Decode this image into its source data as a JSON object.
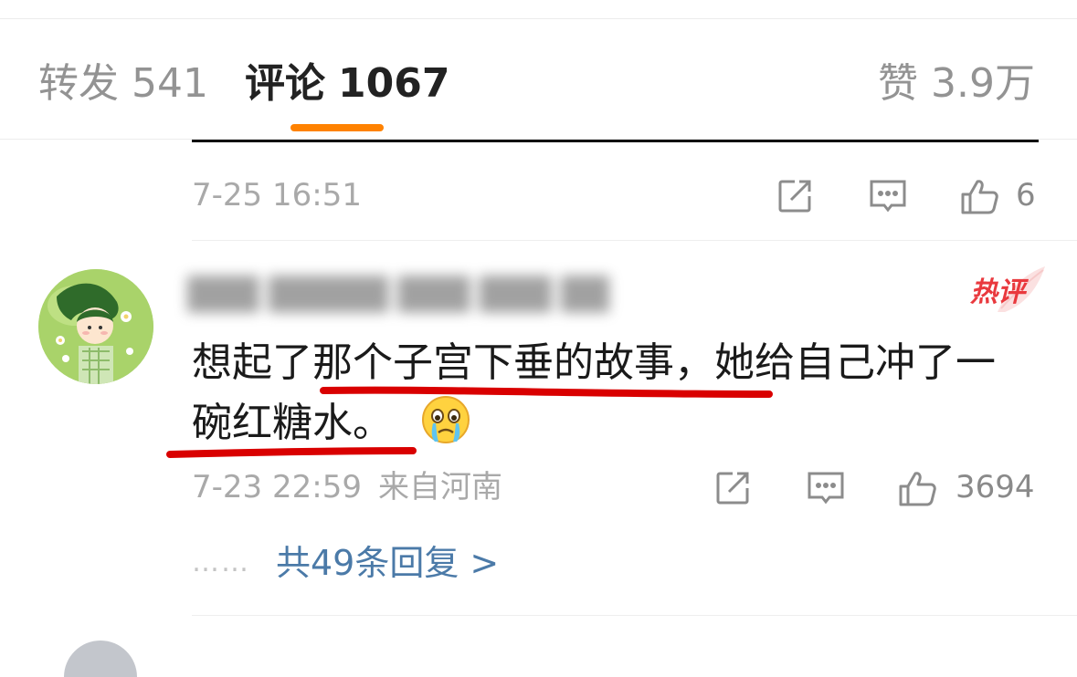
{
  "tabs": {
    "reposts": {
      "label": "转发",
      "count": "541"
    },
    "comments": {
      "label": "评论",
      "count": "1067"
    },
    "likes": {
      "label": "赞",
      "count": "3.9万"
    }
  },
  "previous_comment": {
    "time": "7-25 16:51",
    "like_count": "6"
  },
  "comment": {
    "username": "███ █████ ███ ███ ██",
    "badge": "热评",
    "text": "想起了那个子宫下垂的故事，她给自己冲了一碗红糖水。",
    "emoji": "crying-face-emoji",
    "time": "7-23 22:59",
    "location": "来自河南",
    "like_count": "3694",
    "replies_dots": "……",
    "replies_link": "共49条回复 >"
  },
  "colors": {
    "accent": "#ff8200",
    "hot_badge": "#e9393e",
    "link": "#4b7aa8",
    "annotation_red": "#d90000"
  }
}
